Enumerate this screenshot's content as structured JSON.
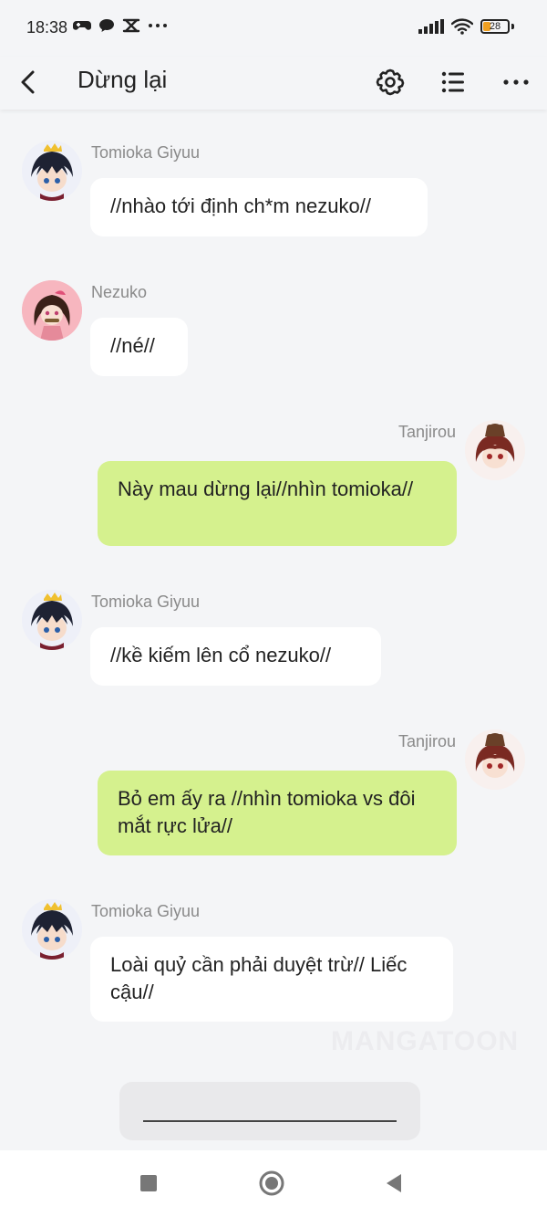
{
  "status": {
    "time": "18:38",
    "icons_left": [
      "game-controller-icon",
      "chat-bubble-icon",
      "capcut-icon",
      "more-dots-icon"
    ],
    "battery": "28"
  },
  "header": {
    "title": "Dừng lại",
    "icons": [
      "back-icon",
      "gear-icon",
      "list-icon",
      "more-icon"
    ]
  },
  "messages": [
    {
      "sender": "Tomioka Giyuu",
      "side": "left",
      "text": "//nhào tới định ch*m nezuko//"
    },
    {
      "sender": "Nezuko",
      "side": "left",
      "text": "//né//"
    },
    {
      "sender": "Tanjirou",
      "side": "right",
      "text": "Này mau dừng lại//nhìn tomioka//"
    },
    {
      "sender": "Tomioka Giyuu",
      "side": "left",
      "text": "//kề kiếm lên cổ nezuko//"
    },
    {
      "sender": "Tanjirou",
      "side": "right",
      "text": "Bỏ em ấy ra //nhìn tomioka vs đôi mắt rực lửa//"
    },
    {
      "sender": "Tomioka Giyuu",
      "side": "left",
      "text": "Loài quỷ cần phải duyệt trừ// Liếc cậu//"
    }
  ],
  "watermark": "MANGATOON",
  "colors": {
    "background": "#f4f5f7",
    "right_bubble": "#d5f18e",
    "left_bubble": "#ffffff",
    "name": "#8a8a8a"
  },
  "nav": [
    "recents-square-icon",
    "home-circle-icon",
    "back-triangle-icon"
  ]
}
